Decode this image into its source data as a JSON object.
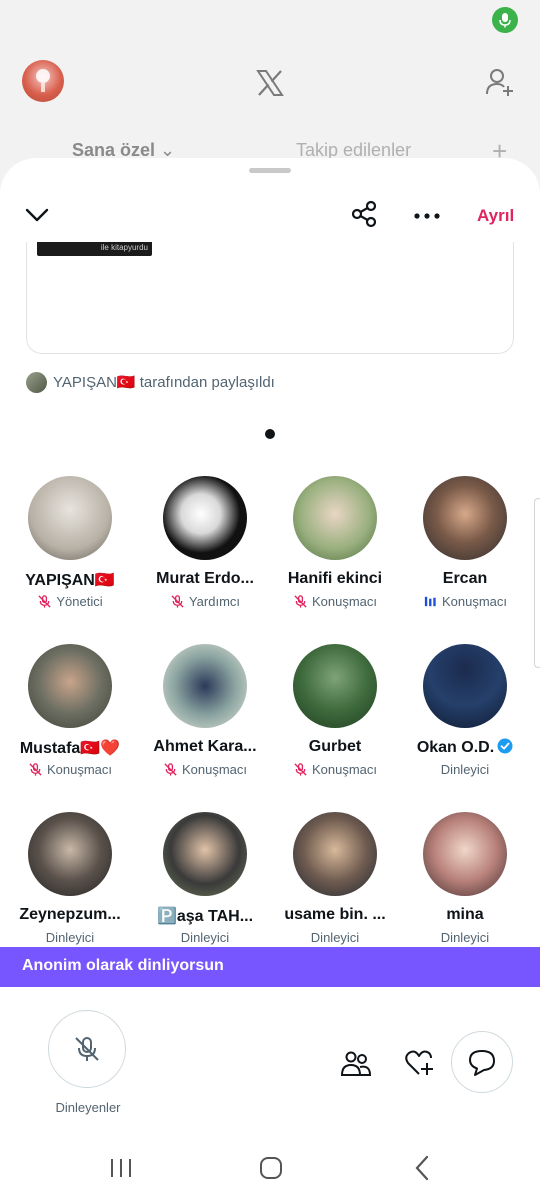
{
  "background": {
    "tabs": {
      "for_you": "Sana özel",
      "following": "Takip edilenler"
    }
  },
  "sheet": {
    "leave_label": "Ayrıl",
    "shared_thumb_text": "ile kitapyurdu",
    "shared_by": "YAPIŞAN🇹🇷 tarafından paylaşıldı",
    "participants": [
      {
        "name": "YAPIŞAN🇹🇷",
        "role": "Yönetici",
        "role_icon": "mic-off-icon"
      },
      {
        "name": "Murat Erdo...",
        "role": "Yardımcı",
        "role_icon": "mic-off-icon"
      },
      {
        "name": "Hanifi ekinci",
        "role": "Konuşmacı",
        "role_icon": "mic-off-icon"
      },
      {
        "name": "Ercan",
        "role": "Konuşmacı",
        "role_icon": "speaking-bars-icon"
      },
      {
        "name": "Mustafa🇹🇷❤️",
        "role": "Konuşmacı",
        "role_icon": "mic-off-icon"
      },
      {
        "name": "Ahmet Kara...",
        "role": "Konuşmacı",
        "role_icon": "mic-off-icon"
      },
      {
        "name": "Gurbet",
        "role": "Konuşmacı",
        "role_icon": "mic-off-icon"
      },
      {
        "name": "Okan O.D.",
        "role": "Dinleyici",
        "role_icon": "verified-icon"
      },
      {
        "name": "Zeynepzum...",
        "role": "Dinleyici",
        "role_icon": ""
      },
      {
        "name": "🅿️aşa TAH...",
        "role": "Dinleyici",
        "role_icon": ""
      },
      {
        "name": "usame bin. ...",
        "role": "Dinleyici",
        "role_icon": ""
      },
      {
        "name": "mina",
        "role": "Dinleyici",
        "role_icon": ""
      }
    ],
    "anon_banner": "Anonim olarak dinliyorsun",
    "mic_label": "Dinleyenler"
  },
  "colors": {
    "accent_purple": "#7856ff",
    "leave_red": "#e0245e",
    "speaker_blue": "#1d4ed8",
    "verified": "#1d9bf0"
  }
}
